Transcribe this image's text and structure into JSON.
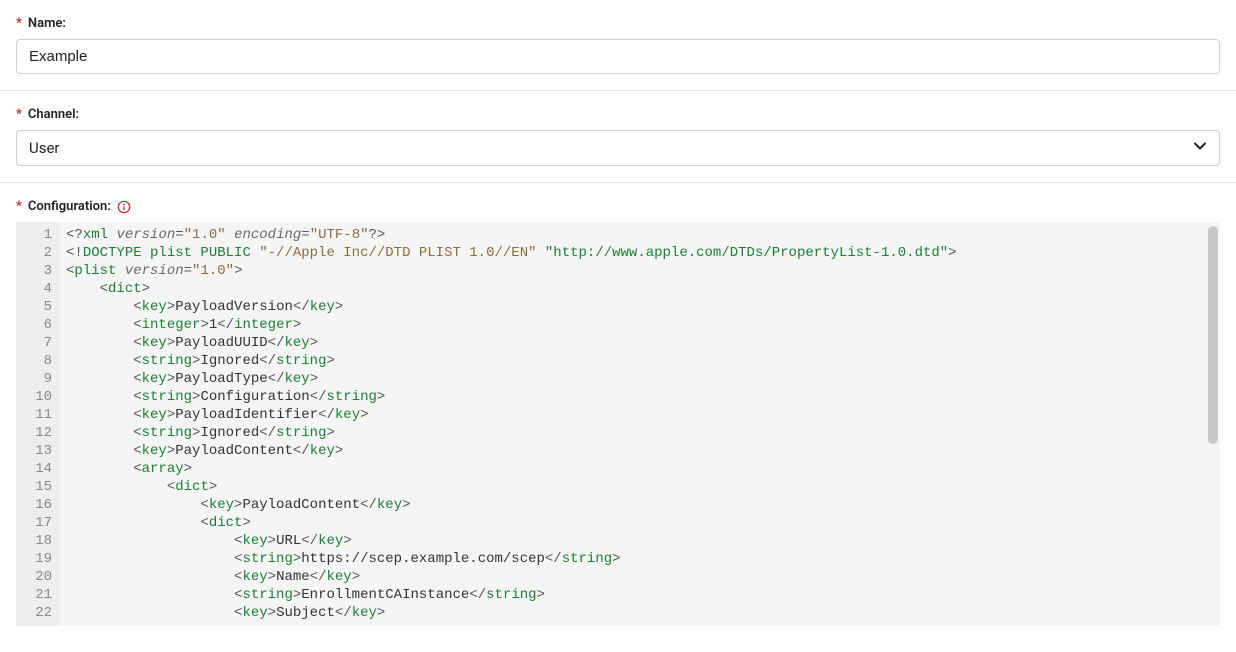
{
  "name": {
    "label": "Name:",
    "value": "Example"
  },
  "channel": {
    "label": "Channel:",
    "value": "User"
  },
  "configuration": {
    "label": "Configuration:",
    "lines": [
      {
        "n": 1,
        "tokens": [
          {
            "t": "<?",
            "c": "punct"
          },
          {
            "t": "xml",
            "c": "pi"
          },
          {
            "t": " ",
            "c": "text"
          },
          {
            "t": "version",
            "c": "attr"
          },
          {
            "t": "=",
            "c": "punct"
          },
          {
            "t": "\"1.0\"",
            "c": "str"
          },
          {
            "t": " ",
            "c": "text"
          },
          {
            "t": "encoding",
            "c": "attr"
          },
          {
            "t": "=",
            "c": "punct"
          },
          {
            "t": "\"UTF-8\"",
            "c": "str"
          },
          {
            "t": "?>",
            "c": "punct"
          }
        ]
      },
      {
        "n": 2,
        "tokens": [
          {
            "t": "<!",
            "c": "punct"
          },
          {
            "t": "DOCTYPE plist PUBLIC ",
            "c": "doctype"
          },
          {
            "t": "\"-//Apple Inc//DTD PLIST 1.0//EN\"",
            "c": "str"
          },
          {
            "t": " ",
            "c": "text"
          },
          {
            "t": "\"http://www.apple.com/DTDs/PropertyList-1.0.dtd\"",
            "c": "url"
          },
          {
            "t": ">",
            "c": "punct"
          }
        ]
      },
      {
        "n": 3,
        "tokens": [
          {
            "t": "<",
            "c": "punct"
          },
          {
            "t": "plist",
            "c": "tag"
          },
          {
            "t": " ",
            "c": "text"
          },
          {
            "t": "version",
            "c": "attr"
          },
          {
            "t": "=",
            "c": "punct"
          },
          {
            "t": "\"1.0\"",
            "c": "str"
          },
          {
            "t": ">",
            "c": "punct"
          }
        ]
      },
      {
        "n": 4,
        "tokens": [
          {
            "t": "    ",
            "c": "text"
          },
          {
            "t": "<",
            "c": "punct"
          },
          {
            "t": "dict",
            "c": "tag"
          },
          {
            "t": ">",
            "c": "punct"
          }
        ]
      },
      {
        "n": 5,
        "tokens": [
          {
            "t": "        ",
            "c": "text"
          },
          {
            "t": "<",
            "c": "punct"
          },
          {
            "t": "key",
            "c": "tag"
          },
          {
            "t": ">",
            "c": "punct"
          },
          {
            "t": "PayloadVersion",
            "c": "text"
          },
          {
            "t": "</",
            "c": "punct"
          },
          {
            "t": "key",
            "c": "tag"
          },
          {
            "t": ">",
            "c": "punct"
          }
        ]
      },
      {
        "n": 6,
        "tokens": [
          {
            "t": "        ",
            "c": "text"
          },
          {
            "t": "<",
            "c": "punct"
          },
          {
            "t": "integer",
            "c": "tag"
          },
          {
            "t": ">",
            "c": "punct"
          },
          {
            "t": "1",
            "c": "text"
          },
          {
            "t": "</",
            "c": "punct"
          },
          {
            "t": "integer",
            "c": "tag"
          },
          {
            "t": ">",
            "c": "punct"
          }
        ]
      },
      {
        "n": 7,
        "tokens": [
          {
            "t": "        ",
            "c": "text"
          },
          {
            "t": "<",
            "c": "punct"
          },
          {
            "t": "key",
            "c": "tag"
          },
          {
            "t": ">",
            "c": "punct"
          },
          {
            "t": "PayloadUUID",
            "c": "text"
          },
          {
            "t": "</",
            "c": "punct"
          },
          {
            "t": "key",
            "c": "tag"
          },
          {
            "t": ">",
            "c": "punct"
          }
        ]
      },
      {
        "n": 8,
        "tokens": [
          {
            "t": "        ",
            "c": "text"
          },
          {
            "t": "<",
            "c": "punct"
          },
          {
            "t": "string",
            "c": "tag"
          },
          {
            "t": ">",
            "c": "punct"
          },
          {
            "t": "Ignored",
            "c": "text"
          },
          {
            "t": "</",
            "c": "punct"
          },
          {
            "t": "string",
            "c": "tag"
          },
          {
            "t": ">",
            "c": "punct"
          }
        ]
      },
      {
        "n": 9,
        "tokens": [
          {
            "t": "        ",
            "c": "text"
          },
          {
            "t": "<",
            "c": "punct"
          },
          {
            "t": "key",
            "c": "tag"
          },
          {
            "t": ">",
            "c": "punct"
          },
          {
            "t": "PayloadType",
            "c": "text"
          },
          {
            "t": "</",
            "c": "punct"
          },
          {
            "t": "key",
            "c": "tag"
          },
          {
            "t": ">",
            "c": "punct"
          }
        ]
      },
      {
        "n": 10,
        "tokens": [
          {
            "t": "        ",
            "c": "text"
          },
          {
            "t": "<",
            "c": "punct"
          },
          {
            "t": "string",
            "c": "tag"
          },
          {
            "t": ">",
            "c": "punct"
          },
          {
            "t": "Configuration",
            "c": "text"
          },
          {
            "t": "</",
            "c": "punct"
          },
          {
            "t": "string",
            "c": "tag"
          },
          {
            "t": ">",
            "c": "punct"
          }
        ]
      },
      {
        "n": 11,
        "tokens": [
          {
            "t": "        ",
            "c": "text"
          },
          {
            "t": "<",
            "c": "punct"
          },
          {
            "t": "key",
            "c": "tag"
          },
          {
            "t": ">",
            "c": "punct"
          },
          {
            "t": "PayloadIdentifier",
            "c": "text"
          },
          {
            "t": "</",
            "c": "punct"
          },
          {
            "t": "key",
            "c": "tag"
          },
          {
            "t": ">",
            "c": "punct"
          }
        ]
      },
      {
        "n": 12,
        "tokens": [
          {
            "t": "        ",
            "c": "text"
          },
          {
            "t": "<",
            "c": "punct"
          },
          {
            "t": "string",
            "c": "tag"
          },
          {
            "t": ">",
            "c": "punct"
          },
          {
            "t": "Ignored",
            "c": "text"
          },
          {
            "t": "</",
            "c": "punct"
          },
          {
            "t": "string",
            "c": "tag"
          },
          {
            "t": ">",
            "c": "punct"
          }
        ]
      },
      {
        "n": 13,
        "tokens": [
          {
            "t": "        ",
            "c": "text"
          },
          {
            "t": "<",
            "c": "punct"
          },
          {
            "t": "key",
            "c": "tag"
          },
          {
            "t": ">",
            "c": "punct"
          },
          {
            "t": "PayloadContent",
            "c": "text"
          },
          {
            "t": "</",
            "c": "punct"
          },
          {
            "t": "key",
            "c": "tag"
          },
          {
            "t": ">",
            "c": "punct"
          }
        ]
      },
      {
        "n": 14,
        "tokens": [
          {
            "t": "        ",
            "c": "text"
          },
          {
            "t": "<",
            "c": "punct"
          },
          {
            "t": "array",
            "c": "tag"
          },
          {
            "t": ">",
            "c": "punct"
          }
        ]
      },
      {
        "n": 15,
        "tokens": [
          {
            "t": "            ",
            "c": "text"
          },
          {
            "t": "<",
            "c": "punct"
          },
          {
            "t": "dict",
            "c": "tag"
          },
          {
            "t": ">",
            "c": "punct"
          }
        ]
      },
      {
        "n": 16,
        "tokens": [
          {
            "t": "                ",
            "c": "text"
          },
          {
            "t": "<",
            "c": "punct"
          },
          {
            "t": "key",
            "c": "tag"
          },
          {
            "t": ">",
            "c": "punct"
          },
          {
            "t": "PayloadContent",
            "c": "text"
          },
          {
            "t": "</",
            "c": "punct"
          },
          {
            "t": "key",
            "c": "tag"
          },
          {
            "t": ">",
            "c": "punct"
          }
        ]
      },
      {
        "n": 17,
        "tokens": [
          {
            "t": "                ",
            "c": "text"
          },
          {
            "t": "<",
            "c": "punct"
          },
          {
            "t": "dict",
            "c": "tag"
          },
          {
            "t": ">",
            "c": "punct"
          }
        ]
      },
      {
        "n": 18,
        "tokens": [
          {
            "t": "                    ",
            "c": "text"
          },
          {
            "t": "<",
            "c": "punct"
          },
          {
            "t": "key",
            "c": "tag"
          },
          {
            "t": ">",
            "c": "punct"
          },
          {
            "t": "URL",
            "c": "text"
          },
          {
            "t": "</",
            "c": "punct"
          },
          {
            "t": "key",
            "c": "tag"
          },
          {
            "t": ">",
            "c": "punct"
          }
        ]
      },
      {
        "n": 19,
        "tokens": [
          {
            "t": "                    ",
            "c": "text"
          },
          {
            "t": "<",
            "c": "punct"
          },
          {
            "t": "string",
            "c": "tag"
          },
          {
            "t": ">",
            "c": "punct"
          },
          {
            "t": "https://scep.example.com/scep",
            "c": "text"
          },
          {
            "t": "</",
            "c": "punct"
          },
          {
            "t": "string",
            "c": "tag"
          },
          {
            "t": ">",
            "c": "punct"
          }
        ]
      },
      {
        "n": 20,
        "tokens": [
          {
            "t": "                    ",
            "c": "text"
          },
          {
            "t": "<",
            "c": "punct"
          },
          {
            "t": "key",
            "c": "tag"
          },
          {
            "t": ">",
            "c": "punct"
          },
          {
            "t": "Name",
            "c": "text"
          },
          {
            "t": "</",
            "c": "punct"
          },
          {
            "t": "key",
            "c": "tag"
          },
          {
            "t": ">",
            "c": "punct"
          }
        ]
      },
      {
        "n": 21,
        "tokens": [
          {
            "t": "                    ",
            "c": "text"
          },
          {
            "t": "<",
            "c": "punct"
          },
          {
            "t": "string",
            "c": "tag"
          },
          {
            "t": ">",
            "c": "punct"
          },
          {
            "t": "EnrollmentCAInstance",
            "c": "text"
          },
          {
            "t": "</",
            "c": "punct"
          },
          {
            "t": "string",
            "c": "tag"
          },
          {
            "t": ">",
            "c": "punct"
          }
        ]
      },
      {
        "n": 22,
        "tokens": [
          {
            "t": "                    ",
            "c": "text"
          },
          {
            "t": "<",
            "c": "punct"
          },
          {
            "t": "key",
            "c": "tag"
          },
          {
            "t": ">",
            "c": "punct"
          },
          {
            "t": "Subject",
            "c": "text"
          },
          {
            "t": "</",
            "c": "punct"
          },
          {
            "t": "key",
            "c": "tag"
          },
          {
            "t": ">",
            "c": "punct"
          }
        ]
      }
    ]
  }
}
